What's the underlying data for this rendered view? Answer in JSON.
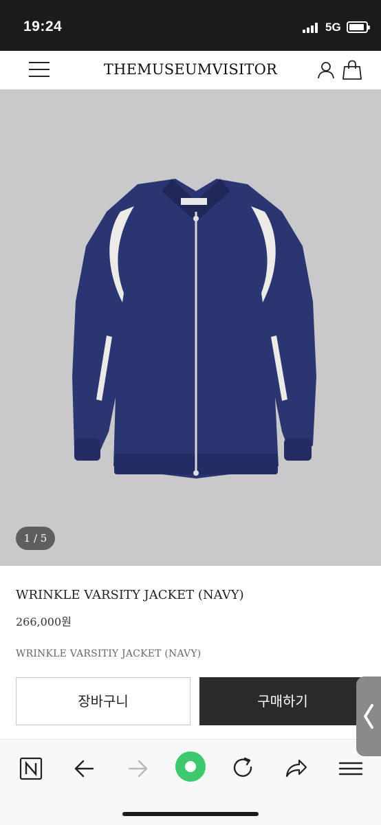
{
  "status_bar": {
    "time": "19:24",
    "network": "5G"
  },
  "header": {
    "brand": "THEMUSEUMVISITOR",
    "icons": [
      "menu-icon",
      "user-icon",
      "shopping-bag-icon"
    ]
  },
  "gallery": {
    "pager": "1 / 5",
    "current_page": 1,
    "total_pages": 5
  },
  "product": {
    "title": "WRINKLE VARSITY JACKET (NAVY)",
    "price": "266,000원",
    "subtitle": "WRINKLE VARSITIY JACKET (NAVY)"
  },
  "actions": {
    "cart_label": "장바구니",
    "buy_label": "구매하기"
  },
  "browser_toolbar": {
    "icons": [
      "naver-home-icon",
      "back-arrow-icon",
      "forward-arrow-icon",
      "green-dot-icon",
      "reload-icon",
      "share-icon",
      "menu-lines-icon"
    ]
  },
  "colors": {
    "accent_green": "#3ec96c",
    "buy_button": "#2b2b2b",
    "image_bg": "#c9c9cb",
    "jacket_navy": "#2a3572"
  }
}
